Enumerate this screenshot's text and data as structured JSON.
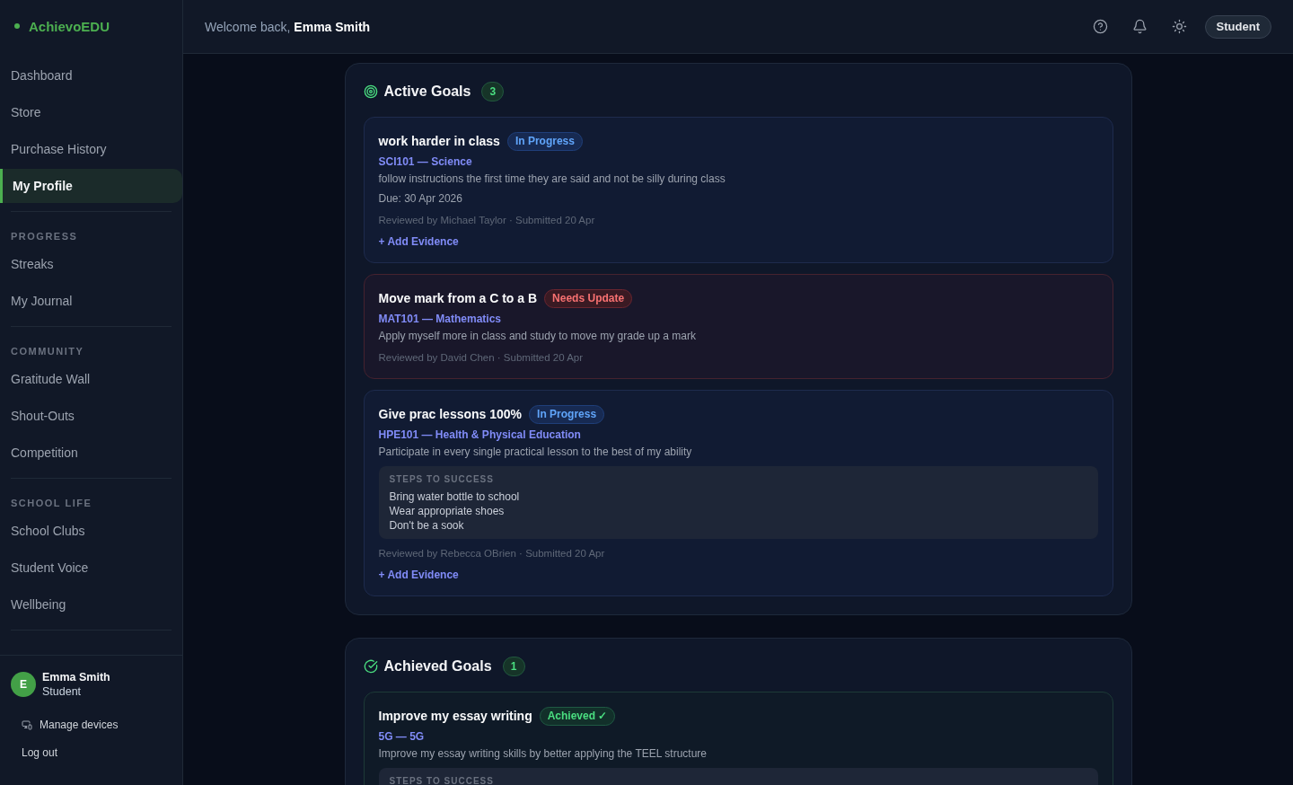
{
  "sidebar": {
    "logo": "AchievoEDU",
    "groups": [
      {
        "items": [
          {
            "label": "Dashboard",
            "selected": false
          },
          {
            "label": "Store",
            "selected": false
          },
          {
            "label": "Purchase History",
            "selected": false
          },
          {
            "label": "My Profile",
            "selected": true
          }
        ]
      },
      {
        "heading": "PROGRESS",
        "items": [
          {
            "label": "Streaks",
            "selected": false
          },
          {
            "label": "My Journal",
            "selected": false
          }
        ]
      },
      {
        "heading": "COMMUNITY",
        "items": [
          {
            "label": "Gratitude Wall",
            "selected": false
          },
          {
            "label": "Shout-Outs",
            "selected": false
          },
          {
            "label": "Competition",
            "selected": false
          }
        ]
      },
      {
        "heading": "SCHOOL LIFE",
        "items": [
          {
            "label": "School Clubs",
            "selected": false
          },
          {
            "label": "Student Voice",
            "selected": false
          },
          {
            "label": "Wellbeing",
            "selected": false
          }
        ]
      }
    ],
    "user": {
      "initial": "E",
      "name": "Emma Smith",
      "role": "Student"
    },
    "links": [
      {
        "label": "Manage devices",
        "kind": "devices"
      },
      {
        "label": "Log out",
        "kind": "plain"
      }
    ]
  },
  "header": {
    "greeting": "Welcome back, **Emma Smith**",
    "role": "Student"
  },
  "sections": [
    {
      "kind": "active",
      "title": "Active Goals",
      "count": "3",
      "goals": [
        {
          "title": "work harder in class",
          "status": {
            "label": "In Progress",
            "kind": "in_progress"
          },
          "subject": "SCI101 — Science",
          "description": "follow instructions the first time they are said and not be silly during class",
          "due": "Due: 30 Apr 2026",
          "review": "Reviewed by Michael Taylor · Submitted 20 Apr",
          "action": "+ Add Evidence"
        },
        {
          "title": "Move mark from a C to a B",
          "status": {
            "label": "Needs Update",
            "kind": "needs_update"
          },
          "subject": "MAT101 — Mathematics",
          "description": "Apply myself more in class and study to move my grade up a mark",
          "review": "Reviewed by David Chen · Submitted 20 Apr"
        },
        {
          "title": "Give prac lessons 100%",
          "status": {
            "label": "In Progress",
            "kind": "in_progress"
          },
          "subject": "HPE101 — Health & Physical Education",
          "description": "Participate in every single practical lesson to the best of my ability",
          "steps": {
            "heading": "STEPS TO SUCCESS",
            "items": [
              "Bring water bottle to school",
              "Wear appropriate shoes",
              "Don't be a sook"
            ]
          },
          "review": "Reviewed by Rebecca OBrien · Submitted 20 Apr",
          "action": "+ Add Evidence"
        }
      ]
    },
    {
      "kind": "achieved",
      "title": "Achieved Goals",
      "count": "1",
      "goals": [
        {
          "title": "Improve my essay writing",
          "status": {
            "label": "Achieved ✓",
            "kind": "achieved"
          },
          "subject": "5G — 5G",
          "description": "Improve my essay writing skills by better applying the TEEL structure",
          "steps": {
            "heading": "STEPS TO SUCCESS"
          }
        }
      ]
    }
  ]
}
